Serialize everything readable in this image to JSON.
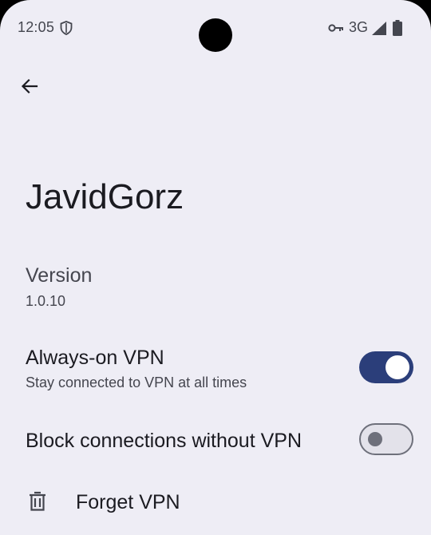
{
  "status_bar": {
    "time": "12:05",
    "network": "3G",
    "icons": [
      "shield-icon",
      "vpn-key-icon",
      "signal-icon",
      "battery-icon"
    ]
  },
  "toolbar": {
    "back_icon": "arrow-back-icon"
  },
  "app": {
    "name": "JavidGorz"
  },
  "preferences": {
    "version": {
      "title": "Version",
      "value": "1.0.10"
    },
    "always_on": {
      "title": "Always-on VPN",
      "summary": "Stay connected to VPN at all times",
      "enabled": true
    },
    "block_connections": {
      "title": "Block connections without VPN",
      "enabled": false
    },
    "forget": {
      "label": "Forget VPN",
      "icon": "trash-icon"
    }
  },
  "colors": {
    "background": "#eeedf5",
    "switch_on": "#2b3e7a",
    "switch_off_outline": "#6e707b"
  }
}
